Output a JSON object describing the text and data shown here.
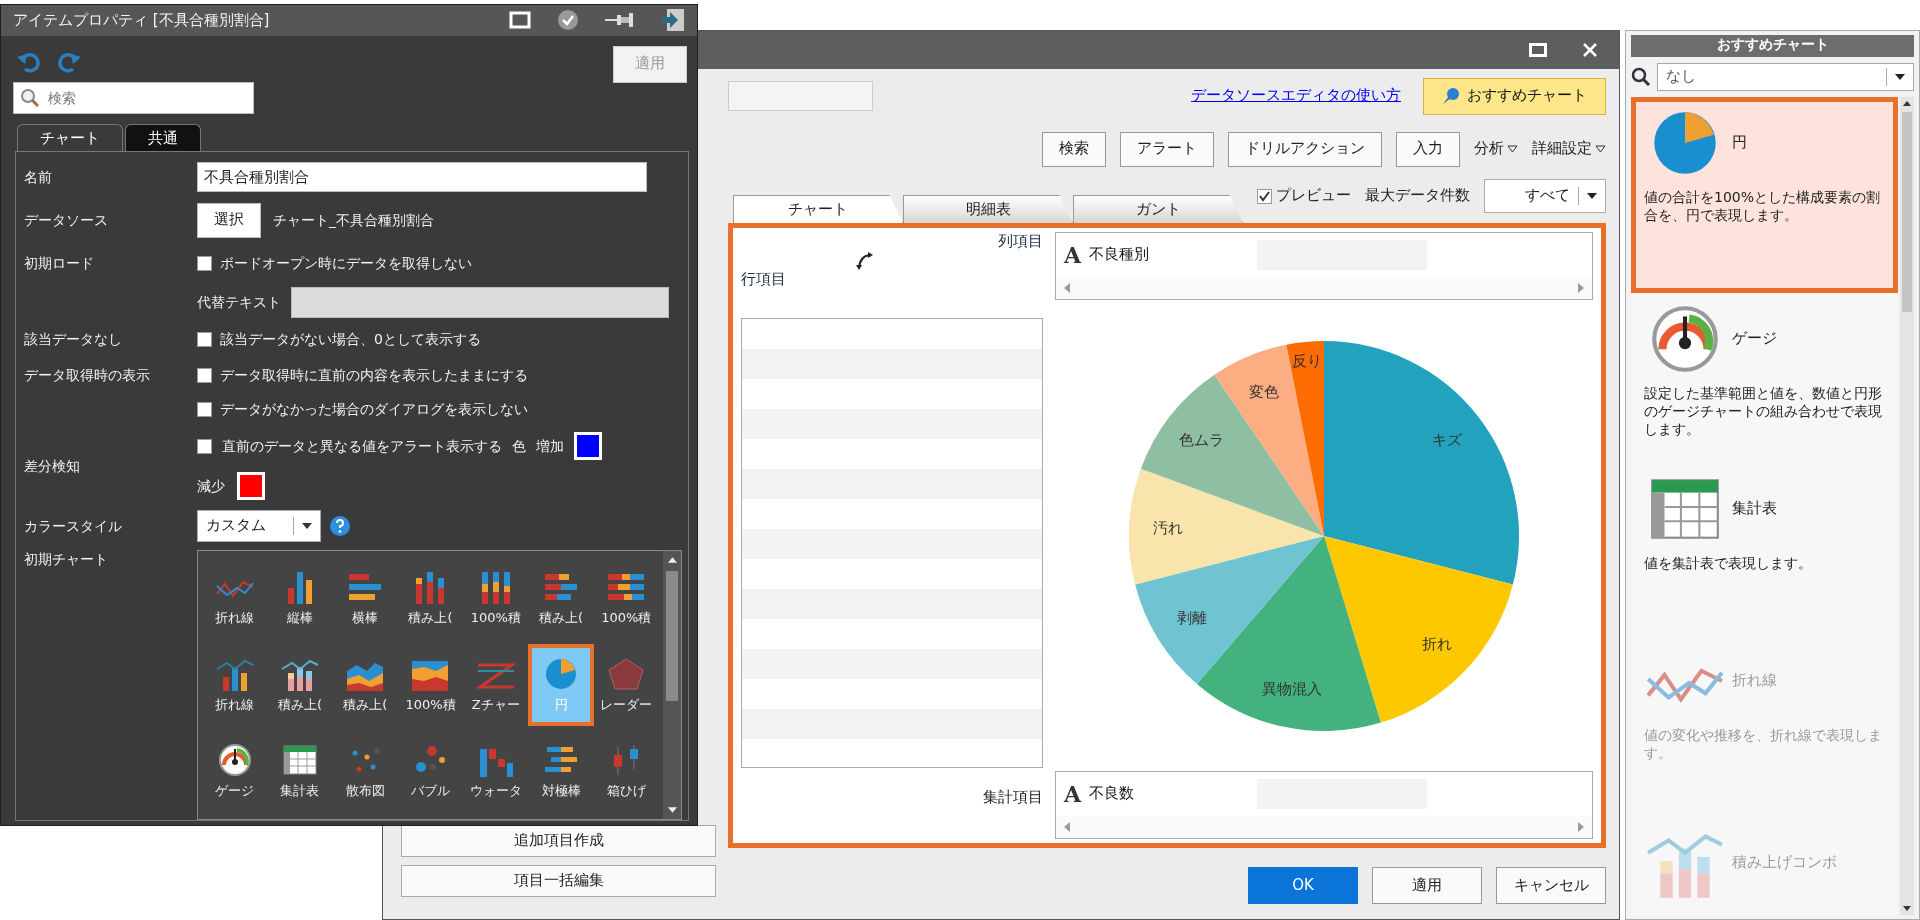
{
  "property_panel": {
    "title": "アイテムプロパティ [不具合種別割合]",
    "apply_button": {
      "label": "適用",
      "disabled": true
    },
    "search": {
      "placeholder": "検索"
    },
    "tabs": [
      {
        "label": "チャート",
        "selected": true
      },
      {
        "label": "共通",
        "selected": false
      }
    ],
    "name": {
      "label": "名前",
      "value": "不具合種別割合"
    },
    "data_source": {
      "label": "データソース",
      "button": "選択",
      "value": "チャート_不具合種別割合"
    },
    "initial_load": {
      "label": "初期ロード",
      "option": {
        "label": "ボードオープン時にデータを取得しない",
        "checked": false
      },
      "alt_text": {
        "label": "代替テキスト",
        "disabled": true
      }
    },
    "no_data": {
      "label": "該当データなし",
      "option": {
        "label": "該当データがない場合、0として表示する",
        "checked": false
      }
    },
    "fetch_display": {
      "label": "データ取得時の表示",
      "options": [
        {
          "label": "データ取得時に直前の内容を表示したままにする",
          "checked": false
        },
        {
          "label": "データがなかった場合のダイアログを表示しない",
          "checked": false
        }
      ]
    },
    "diff_detect": {
      "label": "差分検知",
      "option": {
        "label": "直前のデータと異なる値をアラート表示する",
        "checked": false
      },
      "color_label": "色",
      "colors": [
        {
          "label": "増加",
          "color": "#0000ff"
        },
        {
          "label": "減少",
          "color": "#ff0000"
        }
      ]
    },
    "color_style": {
      "label": "カラースタイル",
      "value": "カスタム"
    },
    "initial_chart": {
      "label": "初期チャート",
      "items": [
        {
          "label": "折れ線",
          "kind": "line",
          "selected": false
        },
        {
          "label": "縦棒",
          "kind": "bar",
          "selected": false
        },
        {
          "label": "横棒",
          "kind": "hbar",
          "selected": false
        },
        {
          "label": "積み上(",
          "kind": "stacked",
          "selected": false
        },
        {
          "label": "100%積",
          "kind": "stacked100",
          "selected": false
        },
        {
          "label": "積み上(",
          "kind": "hstacked",
          "selected": false
        },
        {
          "label": "100%積",
          "kind": "hstacked100",
          "selected": false
        },
        {
          "label": "折れ線",
          "kind": "combo",
          "selected": false
        },
        {
          "label": "積み上(",
          "kind": "combo-stacked",
          "selected": false
        },
        {
          "label": "積み上(",
          "kind": "area",
          "selected": false
        },
        {
          "label": "100%積",
          "kind": "area100",
          "selected": false
        },
        {
          "label": "Zチャー",
          "kind": "z",
          "selected": false
        },
        {
          "label": "円",
          "kind": "pie",
          "selected": true
        },
        {
          "label": "レーダー",
          "kind": "radar",
          "selected": false
        },
        {
          "label": "ゲージ",
          "kind": "gauge",
          "selected": false
        },
        {
          "label": "集計表",
          "kind": "table",
          "selected": false
        },
        {
          "label": "散布図",
          "kind": "scatter",
          "selected": false
        },
        {
          "label": "バブル",
          "kind": "bubble",
          "selected": false
        },
        {
          "label": "ウォータ",
          "kind": "waterfall",
          "selected": false
        },
        {
          "label": "対極棒",
          "kind": "bipolar",
          "selected": false
        },
        {
          "label": "箱ひげ",
          "kind": "boxplot",
          "selected": false
        }
      ]
    }
  },
  "dialog": {
    "side_buttons": [
      "追加項目作成",
      "項目一括編集"
    ],
    "help_link": "データソースエディタの使い方",
    "recommend_button": "おすすめチャート",
    "toolbar_buttons": [
      "検索",
      "アラート",
      "ドリルアクション",
      "入力"
    ],
    "menus": [
      "分析",
      "詳細設定"
    ],
    "preview": {
      "label": "プレビュー",
      "checked": true
    },
    "max_rows": {
      "label": "最大データ件数",
      "value": "すべて"
    },
    "tabs": [
      {
        "label": "チャート",
        "selected": true
      },
      {
        "label": "明細表",
        "selected": false
      },
      {
        "label": "ガント",
        "selected": false
      }
    ],
    "layout": {
      "column_label": "列項目",
      "row_label": "行項目",
      "measure_label": "集計項目",
      "column_field": {
        "type_mark": "A",
        "name": "不良種別"
      },
      "measure_field": {
        "type_mark": "A",
        "name": "不良数"
      }
    },
    "pie": {
      "slices": [
        {
          "label": "キズ",
          "color": "#22a2bd"
        },
        {
          "label": "折れ",
          "color": "#fdc800"
        },
        {
          "label": "異物混入",
          "color": "#43b27f"
        },
        {
          "label": "剥離",
          "color": "#70c3d0"
        },
        {
          "label": "汚れ",
          "color": "#f9e4ab"
        },
        {
          "label": "色ムラ",
          "color": "#8ebfa3"
        },
        {
          "label": "変色",
          "color": "#fdad82"
        },
        {
          "label": "反り",
          "color": "#fc6c00"
        }
      ]
    },
    "footer_buttons": [
      {
        "label": "OK",
        "kind": "primary"
      },
      {
        "label": "適用",
        "kind": "secondary"
      },
      {
        "label": "キャンセル",
        "kind": "secondary"
      }
    ]
  },
  "recommend_panel": {
    "title": "おすすめチャート",
    "filter": "なし",
    "items": [
      {
        "kind": "pie",
        "title": "円",
        "description": "値の合計を100%とした構成要素の割合を、円で表現します。",
        "selected": true,
        "disabled": false
      },
      {
        "kind": "gauge",
        "title": "ゲージ",
        "description": "設定した基準範囲と値を、数値と円形のゲージチャートの組み合わせで表現します。",
        "selected": false,
        "disabled": false
      },
      {
        "kind": "table",
        "title": "集計表",
        "description": "値を集計表で表現します。",
        "selected": false,
        "disabled": false
      },
      {
        "kind": "line",
        "title": "折れ線",
        "description": "値の変化や推移を、折れ線で表現します。",
        "selected": false,
        "disabled": true
      },
      {
        "kind": "combo-stacked",
        "title": "積み上げコンボ",
        "selected": false,
        "disabled": true
      }
    ]
  }
}
